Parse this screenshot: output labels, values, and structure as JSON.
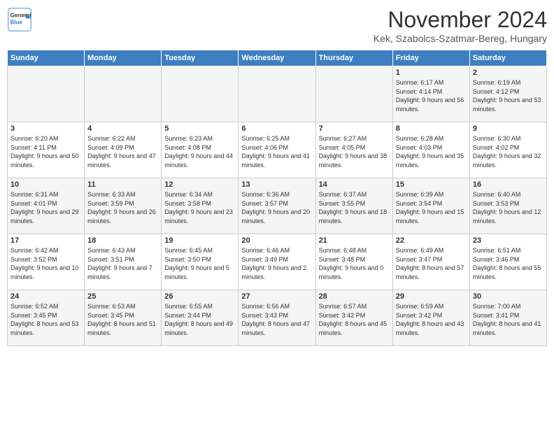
{
  "header": {
    "logo_line1": "General",
    "logo_line2": "Blue",
    "month_title": "November 2024",
    "location": "Kek, Szabolcs-Szatmar-Bereg, Hungary"
  },
  "weekdays": [
    "Sunday",
    "Monday",
    "Tuesday",
    "Wednesday",
    "Thursday",
    "Friday",
    "Saturday"
  ],
  "weeks": [
    [
      {
        "day": "",
        "info": ""
      },
      {
        "day": "",
        "info": ""
      },
      {
        "day": "",
        "info": ""
      },
      {
        "day": "",
        "info": ""
      },
      {
        "day": "",
        "info": ""
      },
      {
        "day": "1",
        "info": "Sunrise: 6:17 AM\nSunset: 4:14 PM\nDaylight: 9 hours and 56 minutes."
      },
      {
        "day": "2",
        "info": "Sunrise: 6:19 AM\nSunset: 4:12 PM\nDaylight: 9 hours and 53 minutes."
      }
    ],
    [
      {
        "day": "3",
        "info": "Sunrise: 6:20 AM\nSunset: 4:11 PM\nDaylight: 9 hours and 50 minutes."
      },
      {
        "day": "4",
        "info": "Sunrise: 6:22 AM\nSunset: 4:09 PM\nDaylight: 9 hours and 47 minutes."
      },
      {
        "day": "5",
        "info": "Sunrise: 6:23 AM\nSunset: 4:08 PM\nDaylight: 9 hours and 44 minutes."
      },
      {
        "day": "6",
        "info": "Sunrise: 6:25 AM\nSunset: 4:06 PM\nDaylight: 9 hours and 41 minutes."
      },
      {
        "day": "7",
        "info": "Sunrise: 6:27 AM\nSunset: 4:05 PM\nDaylight: 9 hours and 38 minutes."
      },
      {
        "day": "8",
        "info": "Sunrise: 6:28 AM\nSunset: 4:03 PM\nDaylight: 9 hours and 35 minutes."
      },
      {
        "day": "9",
        "info": "Sunrise: 6:30 AM\nSunset: 4:02 PM\nDaylight: 9 hours and 32 minutes."
      }
    ],
    [
      {
        "day": "10",
        "info": "Sunrise: 6:31 AM\nSunset: 4:01 PM\nDaylight: 9 hours and 29 minutes."
      },
      {
        "day": "11",
        "info": "Sunrise: 6:33 AM\nSunset: 3:59 PM\nDaylight: 9 hours and 26 minutes."
      },
      {
        "day": "12",
        "info": "Sunrise: 6:34 AM\nSunset: 3:58 PM\nDaylight: 9 hours and 23 minutes."
      },
      {
        "day": "13",
        "info": "Sunrise: 6:36 AM\nSunset: 3:57 PM\nDaylight: 9 hours and 20 minutes."
      },
      {
        "day": "14",
        "info": "Sunrise: 6:37 AM\nSunset: 3:55 PM\nDaylight: 9 hours and 18 minutes."
      },
      {
        "day": "15",
        "info": "Sunrise: 6:39 AM\nSunset: 3:54 PM\nDaylight: 9 hours and 15 minutes."
      },
      {
        "day": "16",
        "info": "Sunrise: 6:40 AM\nSunset: 3:53 PM\nDaylight: 9 hours and 12 minutes."
      }
    ],
    [
      {
        "day": "17",
        "info": "Sunrise: 6:42 AM\nSunset: 3:52 PM\nDaylight: 9 hours and 10 minutes."
      },
      {
        "day": "18",
        "info": "Sunrise: 6:43 AM\nSunset: 3:51 PM\nDaylight: 9 hours and 7 minutes."
      },
      {
        "day": "19",
        "info": "Sunrise: 6:45 AM\nSunset: 3:50 PM\nDaylight: 9 hours and 5 minutes."
      },
      {
        "day": "20",
        "info": "Sunrise: 6:46 AM\nSunset: 3:49 PM\nDaylight: 9 hours and 2 minutes."
      },
      {
        "day": "21",
        "info": "Sunrise: 6:48 AM\nSunset: 3:48 PM\nDaylight: 9 hours and 0 minutes."
      },
      {
        "day": "22",
        "info": "Sunrise: 6:49 AM\nSunset: 3:47 PM\nDaylight: 8 hours and 57 minutes."
      },
      {
        "day": "23",
        "info": "Sunrise: 6:51 AM\nSunset: 3:46 PM\nDaylight: 8 hours and 55 minutes."
      }
    ],
    [
      {
        "day": "24",
        "info": "Sunrise: 6:52 AM\nSunset: 3:45 PM\nDaylight: 8 hours and 53 minutes."
      },
      {
        "day": "25",
        "info": "Sunrise: 6:53 AM\nSunset: 3:45 PM\nDaylight: 8 hours and 51 minutes."
      },
      {
        "day": "26",
        "info": "Sunrise: 6:55 AM\nSunset: 3:44 PM\nDaylight: 8 hours and 49 minutes."
      },
      {
        "day": "27",
        "info": "Sunrise: 6:56 AM\nSunset: 3:43 PM\nDaylight: 8 hours and 47 minutes."
      },
      {
        "day": "28",
        "info": "Sunrise: 6:57 AM\nSunset: 3:42 PM\nDaylight: 8 hours and 45 minutes."
      },
      {
        "day": "29",
        "info": "Sunrise: 6:59 AM\nSunset: 3:42 PM\nDaylight: 8 hours and 43 minutes."
      },
      {
        "day": "30",
        "info": "Sunrise: 7:00 AM\nSunset: 3:41 PM\nDaylight: 8 hours and 41 minutes."
      }
    ]
  ]
}
